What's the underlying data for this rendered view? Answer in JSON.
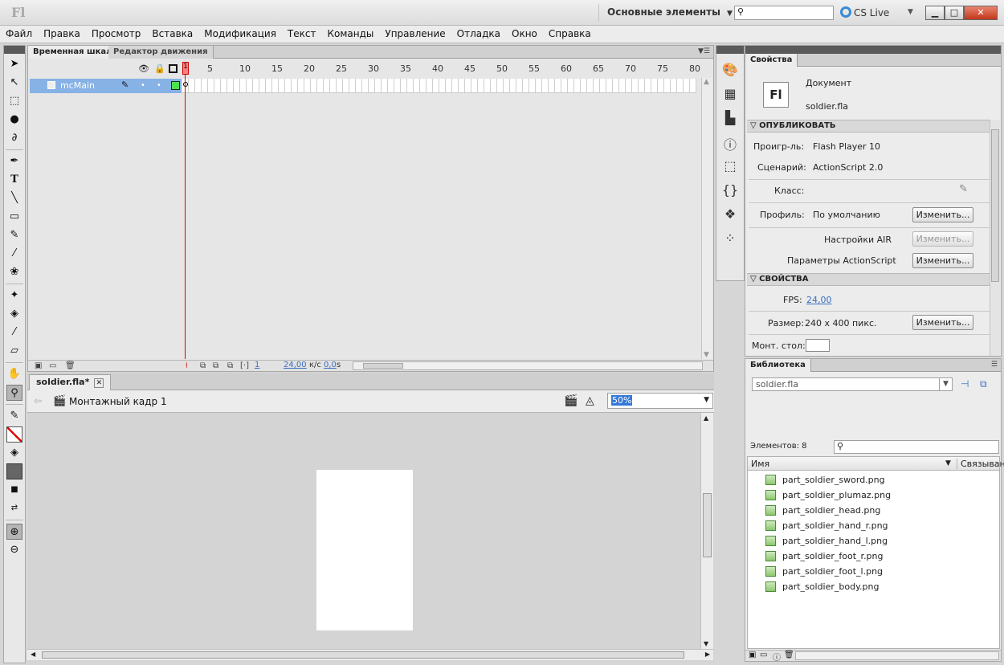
{
  "app": {
    "logo": "Fl"
  },
  "titlebar": {
    "workspace": "Основные элементы",
    "cslive": "CS Live",
    "min": "▁",
    "max": "□",
    "close": "✕"
  },
  "menu": [
    "Файл",
    "Правка",
    "Просмотр",
    "Вставка",
    "Модификация",
    "Текст",
    "Команды",
    "Управление",
    "Отладка",
    "Окно",
    "Справка"
  ],
  "timeline": {
    "tabs": [
      "Временная шкала",
      "Редактор движения"
    ],
    "ruler": [
      "1",
      "5",
      "10",
      "15",
      "20",
      "25",
      "30",
      "35",
      "40",
      "45",
      "50",
      "55",
      "60",
      "65",
      "70",
      "75",
      "80"
    ],
    "layer": "mcMain",
    "frame": "1",
    "fps": "24,00",
    "fps_unit": "к/с",
    "time": "0,0",
    "time_unit": "s",
    "playhead": "1"
  },
  "document": {
    "tab": "soldier.fla*",
    "scene": "Монтажный кадр 1",
    "zoom": "50%"
  },
  "properties": {
    "tab": "Свойства",
    "kind": "Документ",
    "file": "soldier.fla",
    "publish_section": "ОПУБЛИКОВАТЬ",
    "player_label": "Проигр-ль:",
    "player_value": "Flash Player 10",
    "script_label": "Сценарий:",
    "script_value": "ActionScript 2.0",
    "class_label": "Класс:",
    "profile_label": "Профиль:",
    "profile_value": "По умолчанию",
    "edit_label": "Изменить...",
    "air_label": "Настройки AIR",
    "as_label": "Параметры ActionScript",
    "props_section": "СВОЙСТВА",
    "fps_label": "FPS:",
    "fps_value": "24,00",
    "size_label": "Размер:",
    "size_value": "240 x 400 пикс.",
    "stage_label": "Монт. стол:"
  },
  "library": {
    "tab": "Библиотека",
    "doc": "soldier.fla",
    "count": "Элементов: 8",
    "col_name": "Имя",
    "col_link": "Связыван",
    "items": [
      "part_soldier_sword.png",
      "part_soldier_plumaz.png",
      "part_soldier_head.png",
      "part_soldier_hand_r.png",
      "part_soldier_hand_l.png",
      "part_soldier_foot_r.png",
      "part_soldier_foot_l.png",
      "part_soldier_body.png"
    ]
  },
  "colors": {
    "layer_highlight": "#86b2e6",
    "playhead": "#ff7f7f",
    "link": "#3a6fc0",
    "layer_color": "#4ce04c"
  }
}
